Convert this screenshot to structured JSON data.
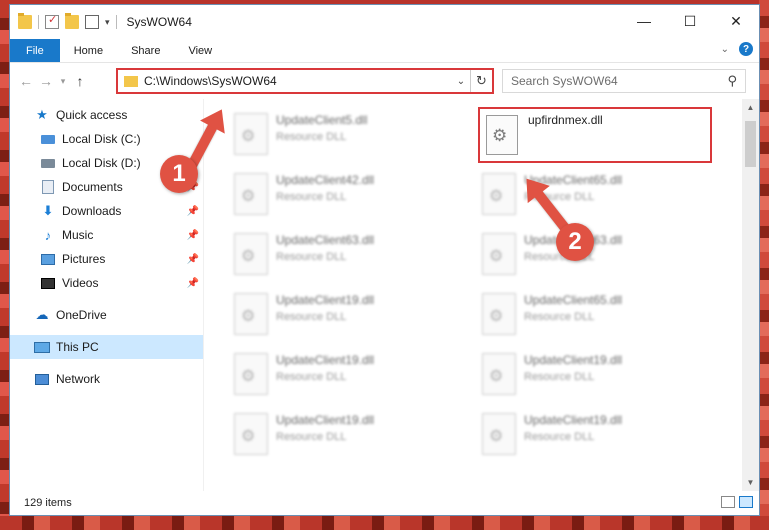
{
  "window": {
    "title": "SysWOW64",
    "controls": [
      "—",
      "☐",
      "✕"
    ]
  },
  "ribbon": {
    "tabs": [
      "File",
      "Home",
      "Share",
      "View"
    ],
    "help": "?"
  },
  "address": {
    "path": "C:\\Windows\\SysWOW64",
    "search_placeholder": "Search SysWOW64"
  },
  "nav": {
    "items": [
      {
        "label": "Quick access",
        "icon": "star-icon"
      },
      {
        "label": "Local Disk (C:)",
        "icon": "drive-icon"
      },
      {
        "label": "Local Disk (D:)",
        "icon": "drive-icon"
      },
      {
        "label": "Documents",
        "icon": "documents-icon"
      },
      {
        "label": "Downloads",
        "icon": "download-icon"
      },
      {
        "label": "Music",
        "icon": "music-icon"
      },
      {
        "label": "Pictures",
        "icon": "pictures-icon"
      },
      {
        "label": "Videos",
        "icon": "videos-icon"
      },
      {
        "label": "OneDrive",
        "icon": "cloud-icon"
      },
      {
        "label": "This PC",
        "icon": "computer-icon"
      },
      {
        "label": "Network",
        "icon": "network-icon"
      }
    ]
  },
  "files": {
    "left": [
      {
        "name": "UpdateClient5.dll",
        "type": "Resource DLL"
      },
      {
        "name": "UpdateClient42.dll",
        "type": "Resource DLL"
      },
      {
        "name": "UpdateClient63.dll",
        "type": "Resource DLL"
      },
      {
        "name": "UpdateClient19.dll",
        "type": "Resource DLL"
      },
      {
        "name": "UpdateClient19.dll",
        "type": "Resource DLL"
      },
      {
        "name": "UpdateClient19.dll",
        "type": "Resource DLL"
      }
    ],
    "right": [
      {
        "name": "UpdateClient65.dll",
        "type": "Resource DLL"
      },
      {
        "name": "UpdateClient63.dll",
        "type": "Resource DLL"
      },
      {
        "name": "UpdateClient65.dll",
        "type": "Resource DLL"
      },
      {
        "name": "UpdateClient19.dll",
        "type": "Resource DLL"
      },
      {
        "name": "UpdateClient19.dll",
        "type": "Resource DLL"
      }
    ],
    "highlighted": {
      "name": "upfirdnmex.dll"
    }
  },
  "status": {
    "item_count": "129 items"
  },
  "annotations": {
    "step1": "1",
    "step2": "2",
    "color": "#e05243"
  }
}
